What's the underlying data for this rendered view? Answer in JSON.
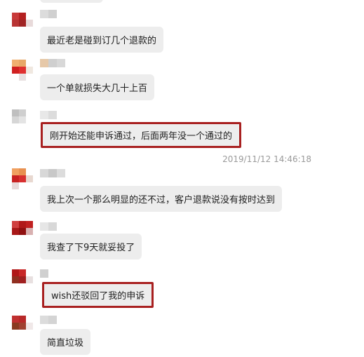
{
  "chat": {
    "messages": [
      {
        "text": "最近老是碰到订几个退款的",
        "highlighted": false
      },
      {
        "text": "一个单就损失大几十上百",
        "highlighted": false
      },
      {
        "text": "刚开始还能申诉通过，后面两年没一个通过的",
        "highlighted": true
      },
      {
        "text": "我上次一个那么明显的还不过，客户退款说没有按时达到",
        "highlighted": false
      },
      {
        "text": "我查了下9天就妥投了",
        "highlighted": false
      },
      {
        "text": "wish还驳回了我的申诉",
        "highlighted": true
      },
      {
        "text": "简直垃圾",
        "highlighted": false
      }
    ],
    "timestamp": "2019/11/12 14:46:18",
    "highlight_color": "#a82020",
    "bubble_color": "#ededed"
  }
}
